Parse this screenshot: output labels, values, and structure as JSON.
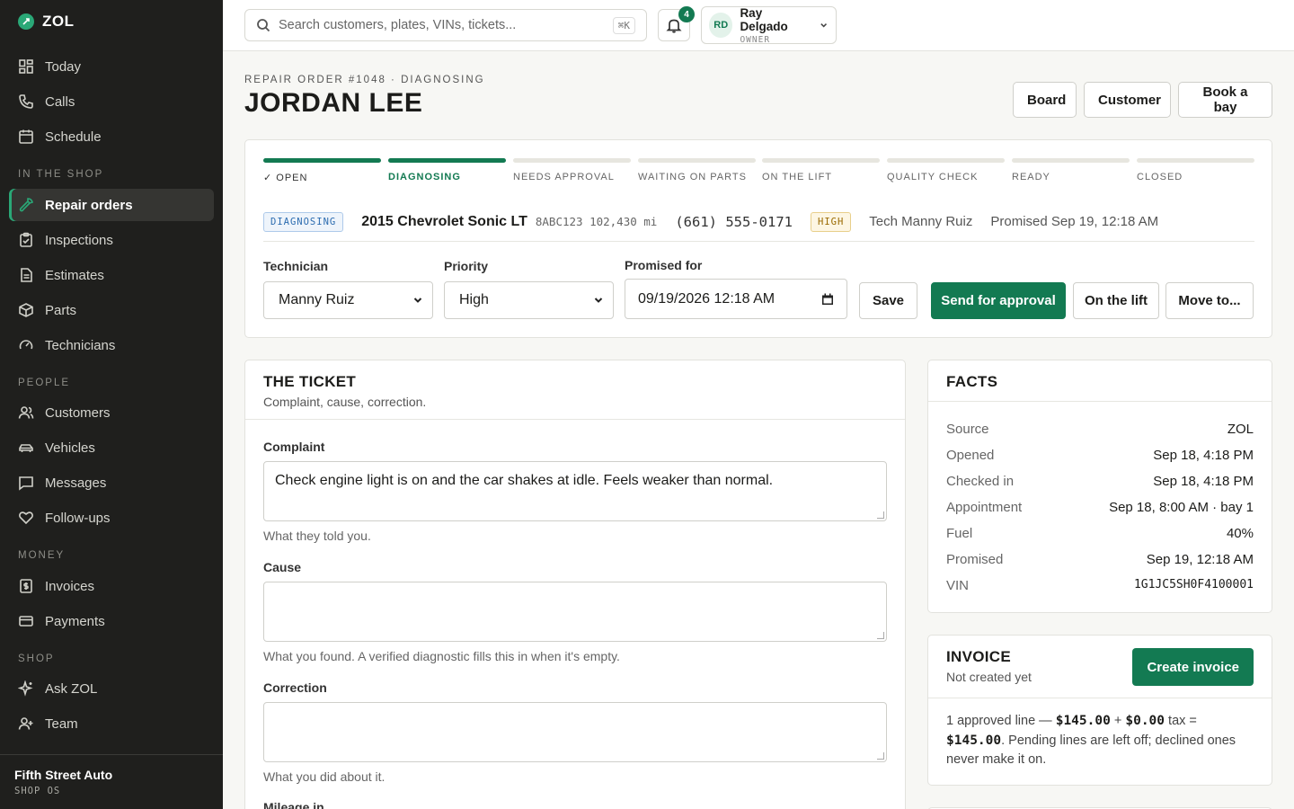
{
  "app": {
    "name": "ZOL"
  },
  "sidebar": {
    "top_items": [
      {
        "label": "Today",
        "icon": "grid-icon"
      },
      {
        "label": "Calls",
        "icon": "phone-icon"
      },
      {
        "label": "Schedule",
        "icon": "calendar-icon"
      }
    ],
    "sections": [
      {
        "title": "IN THE SHOP",
        "items": [
          {
            "label": "Repair orders",
            "icon": "wrench-icon",
            "active": true
          },
          {
            "label": "Inspections",
            "icon": "clipboard-icon"
          },
          {
            "label": "Estimates",
            "icon": "document-icon"
          },
          {
            "label": "Parts",
            "icon": "box-icon"
          },
          {
            "label": "Technicians",
            "icon": "gauge-icon"
          }
        ]
      },
      {
        "title": "PEOPLE",
        "items": [
          {
            "label": "Customers",
            "icon": "users-icon"
          },
          {
            "label": "Vehicles",
            "icon": "car-icon"
          },
          {
            "label": "Messages",
            "icon": "message-icon"
          },
          {
            "label": "Follow-ups",
            "icon": "heart-hand-icon"
          }
        ]
      },
      {
        "title": "MONEY",
        "items": [
          {
            "label": "Invoices",
            "icon": "invoice-icon"
          },
          {
            "label": "Payments",
            "icon": "card-icon"
          }
        ]
      },
      {
        "title": "SHOP",
        "items": [
          {
            "label": "Ask ZOL",
            "icon": "sparkle-icon"
          },
          {
            "label": "Team",
            "icon": "user-plus-icon"
          }
        ]
      }
    ],
    "footer": {
      "shop_name": "Fifth Street Auto",
      "sub": "SHOP OS"
    }
  },
  "topbar": {
    "search_placeholder": "Search customers, plates, VINs, tickets...",
    "shortcut": "⌘K",
    "notification_count": "4",
    "user": {
      "initials": "RD",
      "name": "Ray Delgado",
      "role": "OWNER"
    }
  },
  "header": {
    "eyebrow": "REPAIR ORDER #1048 · DIAGNOSING",
    "title": "JORDAN LEE",
    "buttons": {
      "board": "Board",
      "customer": "Customer",
      "book": "Book a bay"
    }
  },
  "status": {
    "steps": [
      {
        "label": "✓ OPEN",
        "state": "done"
      },
      {
        "label": "DIAGNOSING",
        "state": "current"
      },
      {
        "label": "NEEDS APPROVAL",
        "state": "todo"
      },
      {
        "label": "WAITING ON PARTS",
        "state": "todo"
      },
      {
        "label": "ON THE LIFT",
        "state": "todo"
      },
      {
        "label": "QUALITY CHECK",
        "state": "todo"
      },
      {
        "label": "READY",
        "state": "todo"
      },
      {
        "label": "CLOSED",
        "state": "todo"
      }
    ],
    "status_pill": "DIAGNOSING",
    "vehicle": "2015 Chevrolet Sonic LT",
    "plate_miles": "8ABC123 102,430 mi",
    "phone": "(661) 555-0171",
    "priority_pill": "HIGH",
    "tech": "Tech Manny Ruiz",
    "promised": "Promised Sep 19, 12:18 AM",
    "fields": {
      "technician_label": "Technician",
      "technician_value": "Manny Ruiz",
      "priority_label": "Priority",
      "priority_value": "High",
      "promised_label": "Promised for",
      "promised_value": "09/19/2026 12:18 AM"
    },
    "actions": {
      "save": "Save",
      "send": "Send for approval",
      "lift": "On the lift",
      "move": "Move to..."
    }
  },
  "ticket": {
    "title": "THE TICKET",
    "subtitle": "Complaint, cause, correction.",
    "complaint_label": "Complaint",
    "complaint_value": "Check engine light is on and the car shakes at idle. Feels weaker than normal.",
    "complaint_help": "What they told you.",
    "cause_label": "Cause",
    "cause_help": "What you found. A verified diagnostic fills this in when it's empty.",
    "correction_label": "Correction",
    "correction_help": "What you did about it.",
    "mileage_label": "Mileage in"
  },
  "facts": {
    "title": "FACTS",
    "rows": [
      {
        "k": "Source",
        "v": "ZOL"
      },
      {
        "k": "Opened",
        "v": "Sep 18, 4:18 PM"
      },
      {
        "k": "Checked in",
        "v": "Sep 18, 4:18 PM"
      },
      {
        "k": "Appointment",
        "v": "Sep 18, 8:00 AM · bay 1"
      },
      {
        "k": "Fuel",
        "v": "40%"
      },
      {
        "k": "Promised",
        "v": "Sep 19, 12:18 AM"
      },
      {
        "k": "VIN",
        "v": "1G1JC5SH0F4100001"
      }
    ]
  },
  "invoice": {
    "title": "INVOICE",
    "subtitle": "Not created yet",
    "button": "Create invoice",
    "line_prefix": "1 approved line —",
    "subtotal": "$145.00",
    "plus": "+",
    "tax_amount": "$0.00",
    "tax_word": "tax =",
    "total": "$145.00",
    "note": "Pending lines are left off; declined ones never make it on."
  },
  "colors": {
    "accent": "#137a52",
    "sidebar": "#1f1f1d"
  }
}
